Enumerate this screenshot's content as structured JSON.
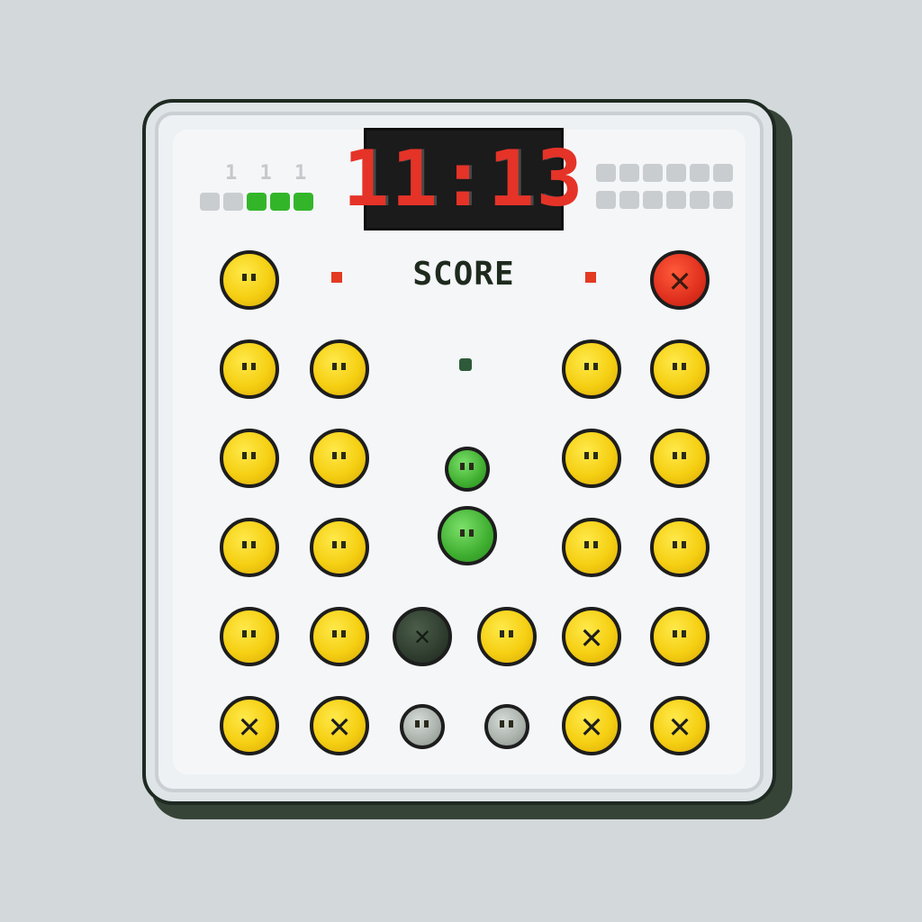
{
  "timer": {
    "value": "11:13"
  },
  "tally": {
    "label": "1 1 1",
    "left_segments": [
      false,
      false,
      true,
      true,
      true
    ],
    "right_rows": 2,
    "right_cols": 6
  },
  "score": {
    "label": "SCORE"
  },
  "colors": {
    "yellow": "#f5cf12",
    "red": "#e0301e",
    "green": "#3fae30",
    "dark": "#2f3d2f",
    "gray": "#a9b0aa",
    "timer_red": "#e53328"
  },
  "tokens": [
    {
      "kind": "yellow",
      "mark": "face"
    },
    {
      "kind": "red",
      "mark": "x"
    },
    {
      "kind": "yellow",
      "mark": "face"
    },
    {
      "kind": "yellow",
      "mark": "face"
    },
    {
      "kind": "yellow",
      "mark": "face"
    },
    {
      "kind": "yellow",
      "mark": "face"
    },
    {
      "kind": "yellow",
      "mark": "face"
    },
    {
      "kind": "yellow",
      "mark": "face"
    },
    {
      "kind": "green",
      "mark": "face"
    },
    {
      "kind": "yellow",
      "mark": "face"
    },
    {
      "kind": "yellow",
      "mark": "face"
    },
    {
      "kind": "yellow",
      "mark": "face"
    },
    {
      "kind": "yellow",
      "mark": "face"
    },
    {
      "kind": "green",
      "mark": "face"
    },
    {
      "kind": "yellow",
      "mark": "face"
    },
    {
      "kind": "yellow",
      "mark": "face"
    },
    {
      "kind": "yellow",
      "mark": "face"
    },
    {
      "kind": "yellow",
      "mark": "face"
    },
    {
      "kind": "dark",
      "mark": "x"
    },
    {
      "kind": "yellow",
      "mark": "face"
    },
    {
      "kind": "yellow",
      "mark": "x"
    },
    {
      "kind": "yellow",
      "mark": "face"
    },
    {
      "kind": "yellow",
      "mark": "x"
    },
    {
      "kind": "yellow",
      "mark": "x"
    },
    {
      "kind": "gray",
      "mark": "face"
    },
    {
      "kind": "gray",
      "mark": "face"
    },
    {
      "kind": "yellow",
      "mark": "x"
    },
    {
      "kind": "yellow",
      "mark": "x"
    }
  ]
}
